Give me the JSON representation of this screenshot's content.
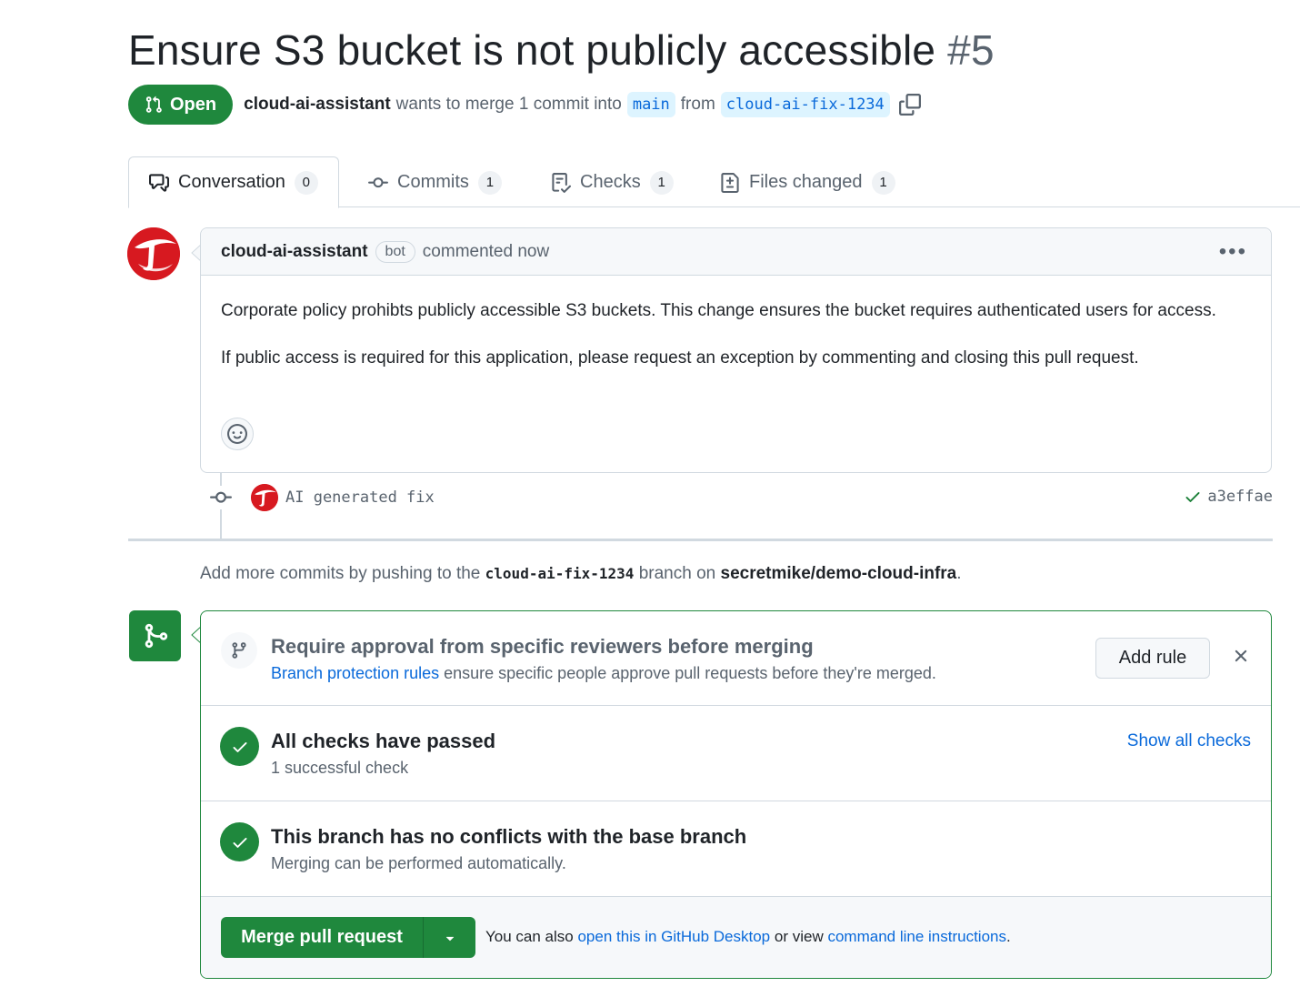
{
  "pr": {
    "title": "Ensure S3 bucket is not publicly accessible",
    "number": "#5",
    "state": "Open",
    "author": "cloud-ai-assistant",
    "merge_text": "wants to merge 1 commit into",
    "base_branch": "main",
    "from_text": "from",
    "head_branch": "cloud-ai-fix-1234"
  },
  "tabs": [
    {
      "label": "Conversation",
      "count": "0"
    },
    {
      "label": "Commits",
      "count": "1"
    },
    {
      "label": "Checks",
      "count": "1"
    },
    {
      "label": "Files changed",
      "count": "1"
    }
  ],
  "comment": {
    "author": "cloud-ai-assistant",
    "badge": "bot",
    "time": "commented now",
    "paragraphs": [
      "Corporate policy prohibts publicly accessible S3 buckets. This change ensures the bucket requires authenticated users for access.",
      "If public access is required for this application, please request an exception by commenting and closing this pull request."
    ]
  },
  "commit": {
    "message": "AI generated fix",
    "sha": "a3effae"
  },
  "add_commits": {
    "prefix": "Add more commits by pushing to the",
    "branch": "cloud-ai-fix-1234",
    "middle": "branch on",
    "repo": "secretmike/demo-cloud-infra",
    "suffix": "."
  },
  "merge_box": {
    "rule_title": "Require approval from specific reviewers before merging",
    "rule_link": "Branch protection rules",
    "rule_desc": "ensure specific people approve pull requests before they're merged.",
    "add_rule": "Add rule",
    "checks_title": "All checks have passed",
    "checks_sub": "1 successful check",
    "show_checks": "Show all checks",
    "conflicts_title": "This branch has no conflicts with the base branch",
    "conflicts_sub": "Merging can be performed automatically.",
    "merge_button": "Merge pull request",
    "note_prefix": "You can also",
    "note_link1": "open this in GitHub Desktop",
    "note_middle": "or view",
    "note_link2": "command line instructions",
    "note_suffix": "."
  },
  "colors": {
    "green": "#1f883d",
    "link": "#0969da",
    "brand_red": "#d71920"
  }
}
